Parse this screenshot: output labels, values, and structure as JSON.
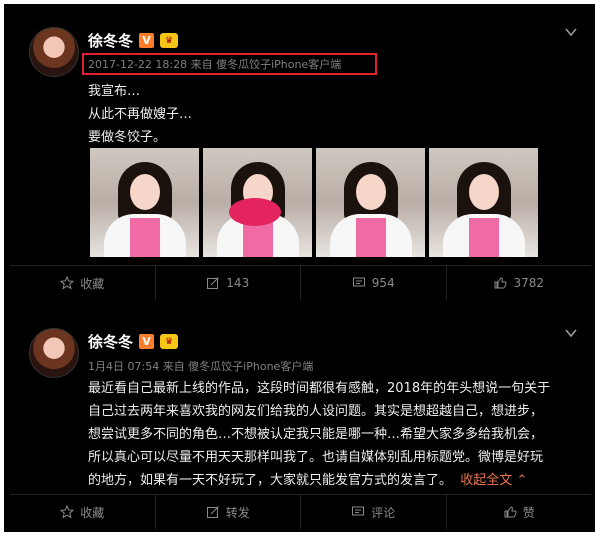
{
  "posts": [
    {
      "user": {
        "name": "徐冬冬",
        "v_badge": "V",
        "crown_badge": "👑"
      },
      "meta": "2017-12-22 18:28 来自 傻冬瓜饺子iPhone客户端",
      "lines": [
        "我宣布…",
        "从此不再做嫂子…",
        "要做冬饺子。"
      ],
      "actions": {
        "favorite": "收藏",
        "repost": "143",
        "comment": "954",
        "like": "3782"
      }
    },
    {
      "user": {
        "name": "徐冬冬",
        "v_badge": "V",
        "crown_badge": "👑"
      },
      "meta": "1月4日 07:54 来自 傻冬瓜饺子iPhone客户端",
      "lines": [
        "最近看自己最新上线的作品，这段时间都很有感触，2018年的年头想说一句关于",
        "自己过去两年来喜欢我的网友们给我的人设问题。其实是想超越自己，想进步，",
        "想尝试更多不同的角色…不想被认定我只能是哪一种…希望大家多多给我机会，",
        "所以真心可以尽量不用天天那样叫我了。也请自媒体别乱用标题党。微博是好玩",
        "的地方，如果有一天不好玩了，大家就只能发官方式的发言了。"
      ],
      "fold_label": "收起全文",
      "actions": {
        "favorite": "收藏",
        "repost": "转发",
        "comment": "评论",
        "like": "赞"
      }
    }
  ],
  "colors": {
    "background": "#000000",
    "meta_highlight": "#e0202a",
    "fold_link": "#eb7350",
    "v_badge": "#ff7d2b"
  }
}
